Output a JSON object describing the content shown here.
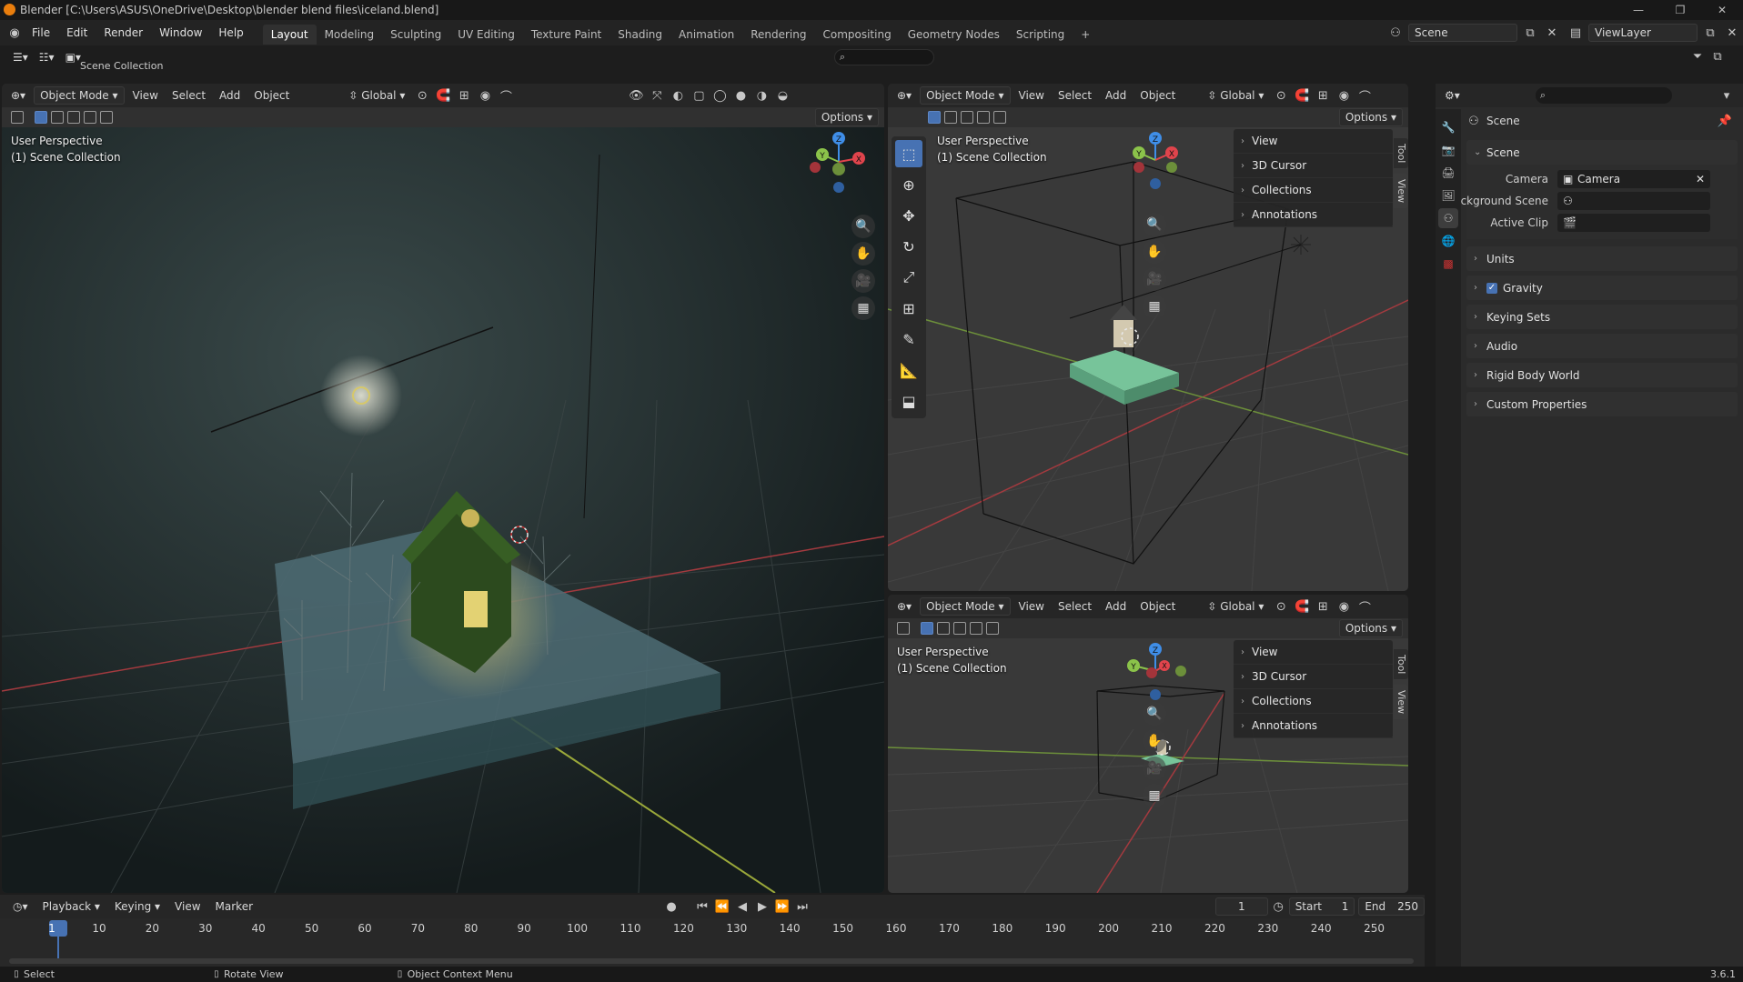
{
  "window": {
    "title": "Blender [C:\\Users\\ASUS\\OneDrive\\Desktop\\blender blend files\\iceland.blend]"
  },
  "menu": [
    "File",
    "Edit",
    "Render",
    "Window",
    "Help"
  ],
  "workspaces": {
    "tabs": [
      "Layout",
      "Modeling",
      "Sculpting",
      "UV Editing",
      "Texture Paint",
      "Shading",
      "Animation",
      "Rendering",
      "Compositing",
      "Geometry Nodes",
      "Scripting"
    ],
    "active": "Layout",
    "add": "+"
  },
  "scene_selector": {
    "value": "Scene"
  },
  "viewlayer_selector": {
    "value": "ViewLayer"
  },
  "outliner_strip": {
    "label": "Scene Collection"
  },
  "viewport_main": {
    "mode": "Object Mode",
    "menus": [
      "View",
      "Select",
      "Add",
      "Object"
    ],
    "orientation": "Global",
    "options": "Options",
    "info_line1": "User Perspective",
    "info_line2": "(1) Scene Collection",
    "gizmo": {
      "z": "Z",
      "y": "Y",
      "x": "X"
    }
  },
  "viewport_top_right": {
    "mode": "Object Mode",
    "menus": [
      "View",
      "Select",
      "Add",
      "Object"
    ],
    "orientation": "Global",
    "options": "Options",
    "info_line1": "User Perspective",
    "info_line2": "(1) Scene Collection",
    "gizmo": {
      "z": "Z",
      "y": "Y",
      "x": "X"
    },
    "npanel_items": [
      "View",
      "3D Cursor",
      "Collections",
      "Annotations"
    ],
    "side_tabs": [
      "Tool",
      "View"
    ]
  },
  "viewport_bottom_right": {
    "mode": "Object Mode",
    "menus": [
      "View",
      "Select",
      "Add",
      "Object"
    ],
    "orientation": "Global",
    "options": "Options",
    "info_line1": "User Perspective",
    "info_line2": "(1) Scene Collection",
    "gizmo": {
      "z": "Z",
      "y": "Y",
      "x": "X"
    },
    "npanel_items": [
      "View",
      "3D Cursor",
      "Collections",
      "Annotations"
    ],
    "side_tabs": [
      "Tool",
      "View"
    ]
  },
  "properties": {
    "breadcrumb": "Scene",
    "section": "Scene",
    "fields": [
      {
        "label": "Camera",
        "value": "Camera"
      },
      {
        "label": "Background Scene",
        "value": ""
      },
      {
        "label": "Active Clip",
        "value": ""
      }
    ],
    "panels": [
      "Units",
      "Gravity",
      "Keying Sets",
      "Audio",
      "Rigid Body World",
      "Custom Properties"
    ],
    "gravity_checked": true
  },
  "timeline": {
    "menus": [
      "Playback",
      "Keying",
      "View",
      "Marker"
    ],
    "current_frame": "1",
    "start_label": "Start",
    "start_value": "1",
    "end_label": "End",
    "end_value": "250",
    "ruler": [
      "1",
      "10",
      "20",
      "30",
      "40",
      "50",
      "60",
      "70",
      "80",
      "90",
      "100",
      "110",
      "120",
      "130",
      "140",
      "150",
      "160",
      "170",
      "180",
      "190",
      "200",
      "210",
      "220",
      "230",
      "240",
      "250"
    ]
  },
  "statusbar": {
    "left": "Select",
    "middle": "Rotate View",
    "right": "Object Context Menu",
    "version": "3.6.1"
  },
  "colors": {
    "accent": "#4772b3",
    "x_axis": "#e0444c",
    "y_axis": "#8bc34a",
    "z_axis": "#3f8ee8"
  }
}
